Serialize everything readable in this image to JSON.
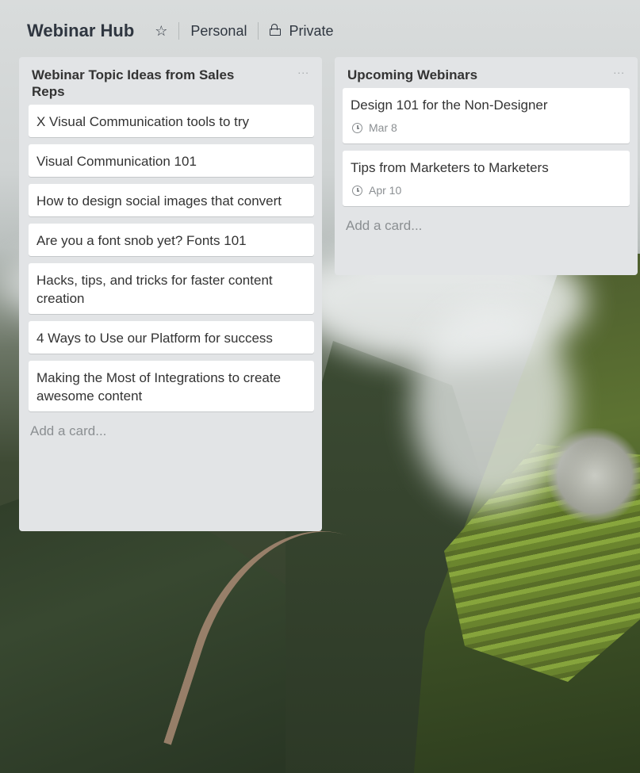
{
  "board": {
    "title": "Webinar Hub",
    "team": "Personal",
    "visibility": "Private"
  },
  "lists": [
    {
      "title": "Webinar Topic Ideas from Sales Reps",
      "menu": "...",
      "cards": [
        {
          "title": "X Visual Communication tools to try"
        },
        {
          "title": "Visual Communication 101"
        },
        {
          "title": "How to design social images that convert"
        },
        {
          "title": "Are you a font snob yet? Fonts 101"
        },
        {
          "title": "Hacks, tips, and tricks for faster content creation"
        },
        {
          "title": "4 Ways to Use our Platform for success"
        },
        {
          "title": "Making the Most of Integrations to create awesome content"
        }
      ],
      "add_card": "Add a card..."
    },
    {
      "title": "Upcoming Webinars",
      "menu": "...",
      "cards": [
        {
          "title": "Design 101 for the Non-Designer",
          "due": "Mar 8"
        },
        {
          "title": "Tips from Marketers to Marketers",
          "due": "Apr 10"
        }
      ],
      "add_card": "Add a card..."
    }
  ],
  "icons": {
    "star": "star-icon",
    "lock": "lock-icon",
    "clock": "clock-icon"
  }
}
